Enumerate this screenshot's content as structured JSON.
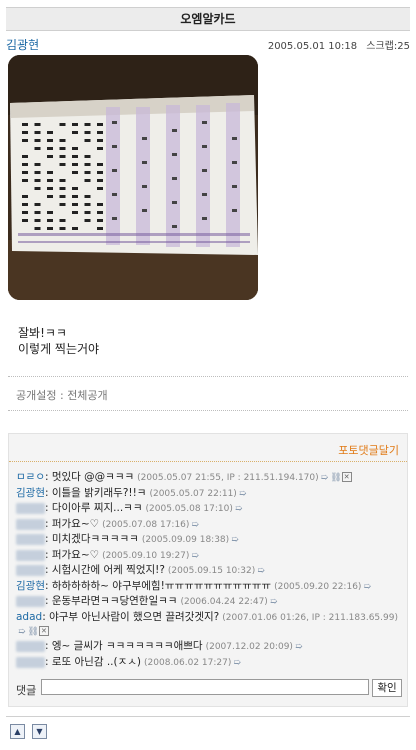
{
  "page": {
    "title": "오엠알카드"
  },
  "post": {
    "author": "김광현",
    "date": "2005.05.01 10:18",
    "scrap_label": "스크랩:",
    "scrap_count": "25",
    "body_line1": "잘봐!ㅋㅋ",
    "body_line2": "이렇게 찍는거야",
    "privacy_label": "공개설정 :",
    "privacy_value": "전체공개"
  },
  "comments_section": {
    "photo_comment_link": "포토댓글달기",
    "input_label": "댓글",
    "input_value": "",
    "submit_label": "확인"
  },
  "comments": [
    {
      "name": "ㅁㄹㅇ",
      "text": ": 멋있다 @@ㅋㅋㅋ",
      "time": "(2005.05.07 21:55, IP : 211.51.194.170)"
    },
    {
      "name": "김광현",
      "text": ": 이틀을 밝키래두?!!ㅋ",
      "time": "(2005.05.07 22:11)"
    },
    {
      "name": "김정현",
      "text": ": 다이아루 찌지...ㅋㅋ",
      "time": "(2005.05.08 17:10)"
    },
    {
      "name": "최현수",
      "text": ": 퍼가요~♡",
      "time": "(2005.07.08 17:16)"
    },
    {
      "name": "김정현",
      "text": ": 미치겠다ㅋㅋㅋㅋㅋ",
      "time": "(2005.09.09 18:38)"
    },
    {
      "name": "김정현",
      "text": ": 퍼가요~♡",
      "time": "(2005.09.10 19:27)"
    },
    {
      "name": "박상현",
      "text": ": 시험시간에 어케 찍었지!?",
      "time": "(2005.09.15 10:32)"
    },
    {
      "name": "김광현",
      "text": ": 하하하하하~ 야구부에힘!ㅠㅠㅠㅠㅠㅠㅠㅠㅠㅠㅠ",
      "time": "(2005.09.20 22:16)"
    },
    {
      "name": "배상현",
      "text": ": 운동부라면ㅋㅋ당연한일ㅋㅋ",
      "time": "(2006.04.24 22:47)"
    },
    {
      "name": "adad",
      "text": ": 야구부 아닌사람이 했으면 끌려갓겟지?",
      "time": "(2007.01.06 01:26, IP : 211.183.65.99)"
    },
    {
      "name": "손상현",
      "text": ": 엥~ 글씨가 ㅋㅋㅋㅋㅋㅋㅋ애쁘다",
      "time": "(2007.12.02 20:09)"
    },
    {
      "name": "김민규",
      "text": ": 로또 아닌감 ..(ㅈㅅ)",
      "time": "(2008.06.02 17:27)"
    }
  ],
  "nav": {
    "up_icon": "up-arrow-icon",
    "down_icon": "down-arrow-icon"
  }
}
